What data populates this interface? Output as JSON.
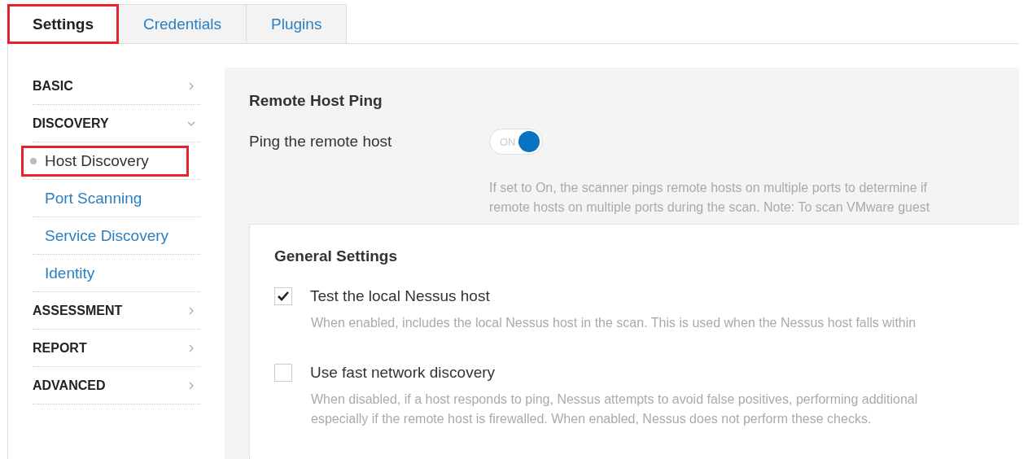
{
  "tabs": [
    {
      "label": "Settings",
      "selected": true,
      "highlighted": true
    },
    {
      "label": "Credentials",
      "selected": false,
      "highlighted": false
    },
    {
      "label": "Plugins",
      "selected": false,
      "highlighted": false
    }
  ],
  "sidebar": {
    "sections": [
      {
        "label": "BASIC",
        "expanded": false
      },
      {
        "label": "DISCOVERY",
        "expanded": true,
        "children": [
          {
            "label": "Host Discovery",
            "selected": true,
            "highlighted": true
          },
          {
            "label": "Port Scanning",
            "selected": false,
            "highlighted": false
          },
          {
            "label": "Service Discovery",
            "selected": false,
            "highlighted": false
          },
          {
            "label": "Identity",
            "selected": false,
            "highlighted": false
          }
        ]
      },
      {
        "label": "ASSESSMENT",
        "expanded": false
      },
      {
        "label": "REPORT",
        "expanded": false
      },
      {
        "label": "ADVANCED",
        "expanded": false
      }
    ]
  },
  "remote_host_ping": {
    "title": "Remote Host Ping",
    "setting": {
      "label": "Ping the remote host",
      "on": true,
      "toggle_text": "ON"
    },
    "description": [
      "If set to On, the scanner pings remote hosts on multiple ports to determine if",
      "remote hosts on multiple ports during the scan. Note: To scan VMware guest"
    ]
  },
  "general_settings": {
    "title": "General Settings",
    "options": [
      {
        "label": "Test the local Nessus host",
        "checked": true,
        "description": [
          "When enabled, includes the local Nessus host in the scan. This is used when the Nessus host falls within"
        ]
      },
      {
        "label": "Use fast network discovery",
        "checked": false,
        "description": [
          "When disabled, if a host responds to ping, Nessus attempts to avoid false positives, performing additional",
          "especially if the remote host is firewalled. When enabled, Nessus does not perform these checks."
        ]
      }
    ]
  }
}
